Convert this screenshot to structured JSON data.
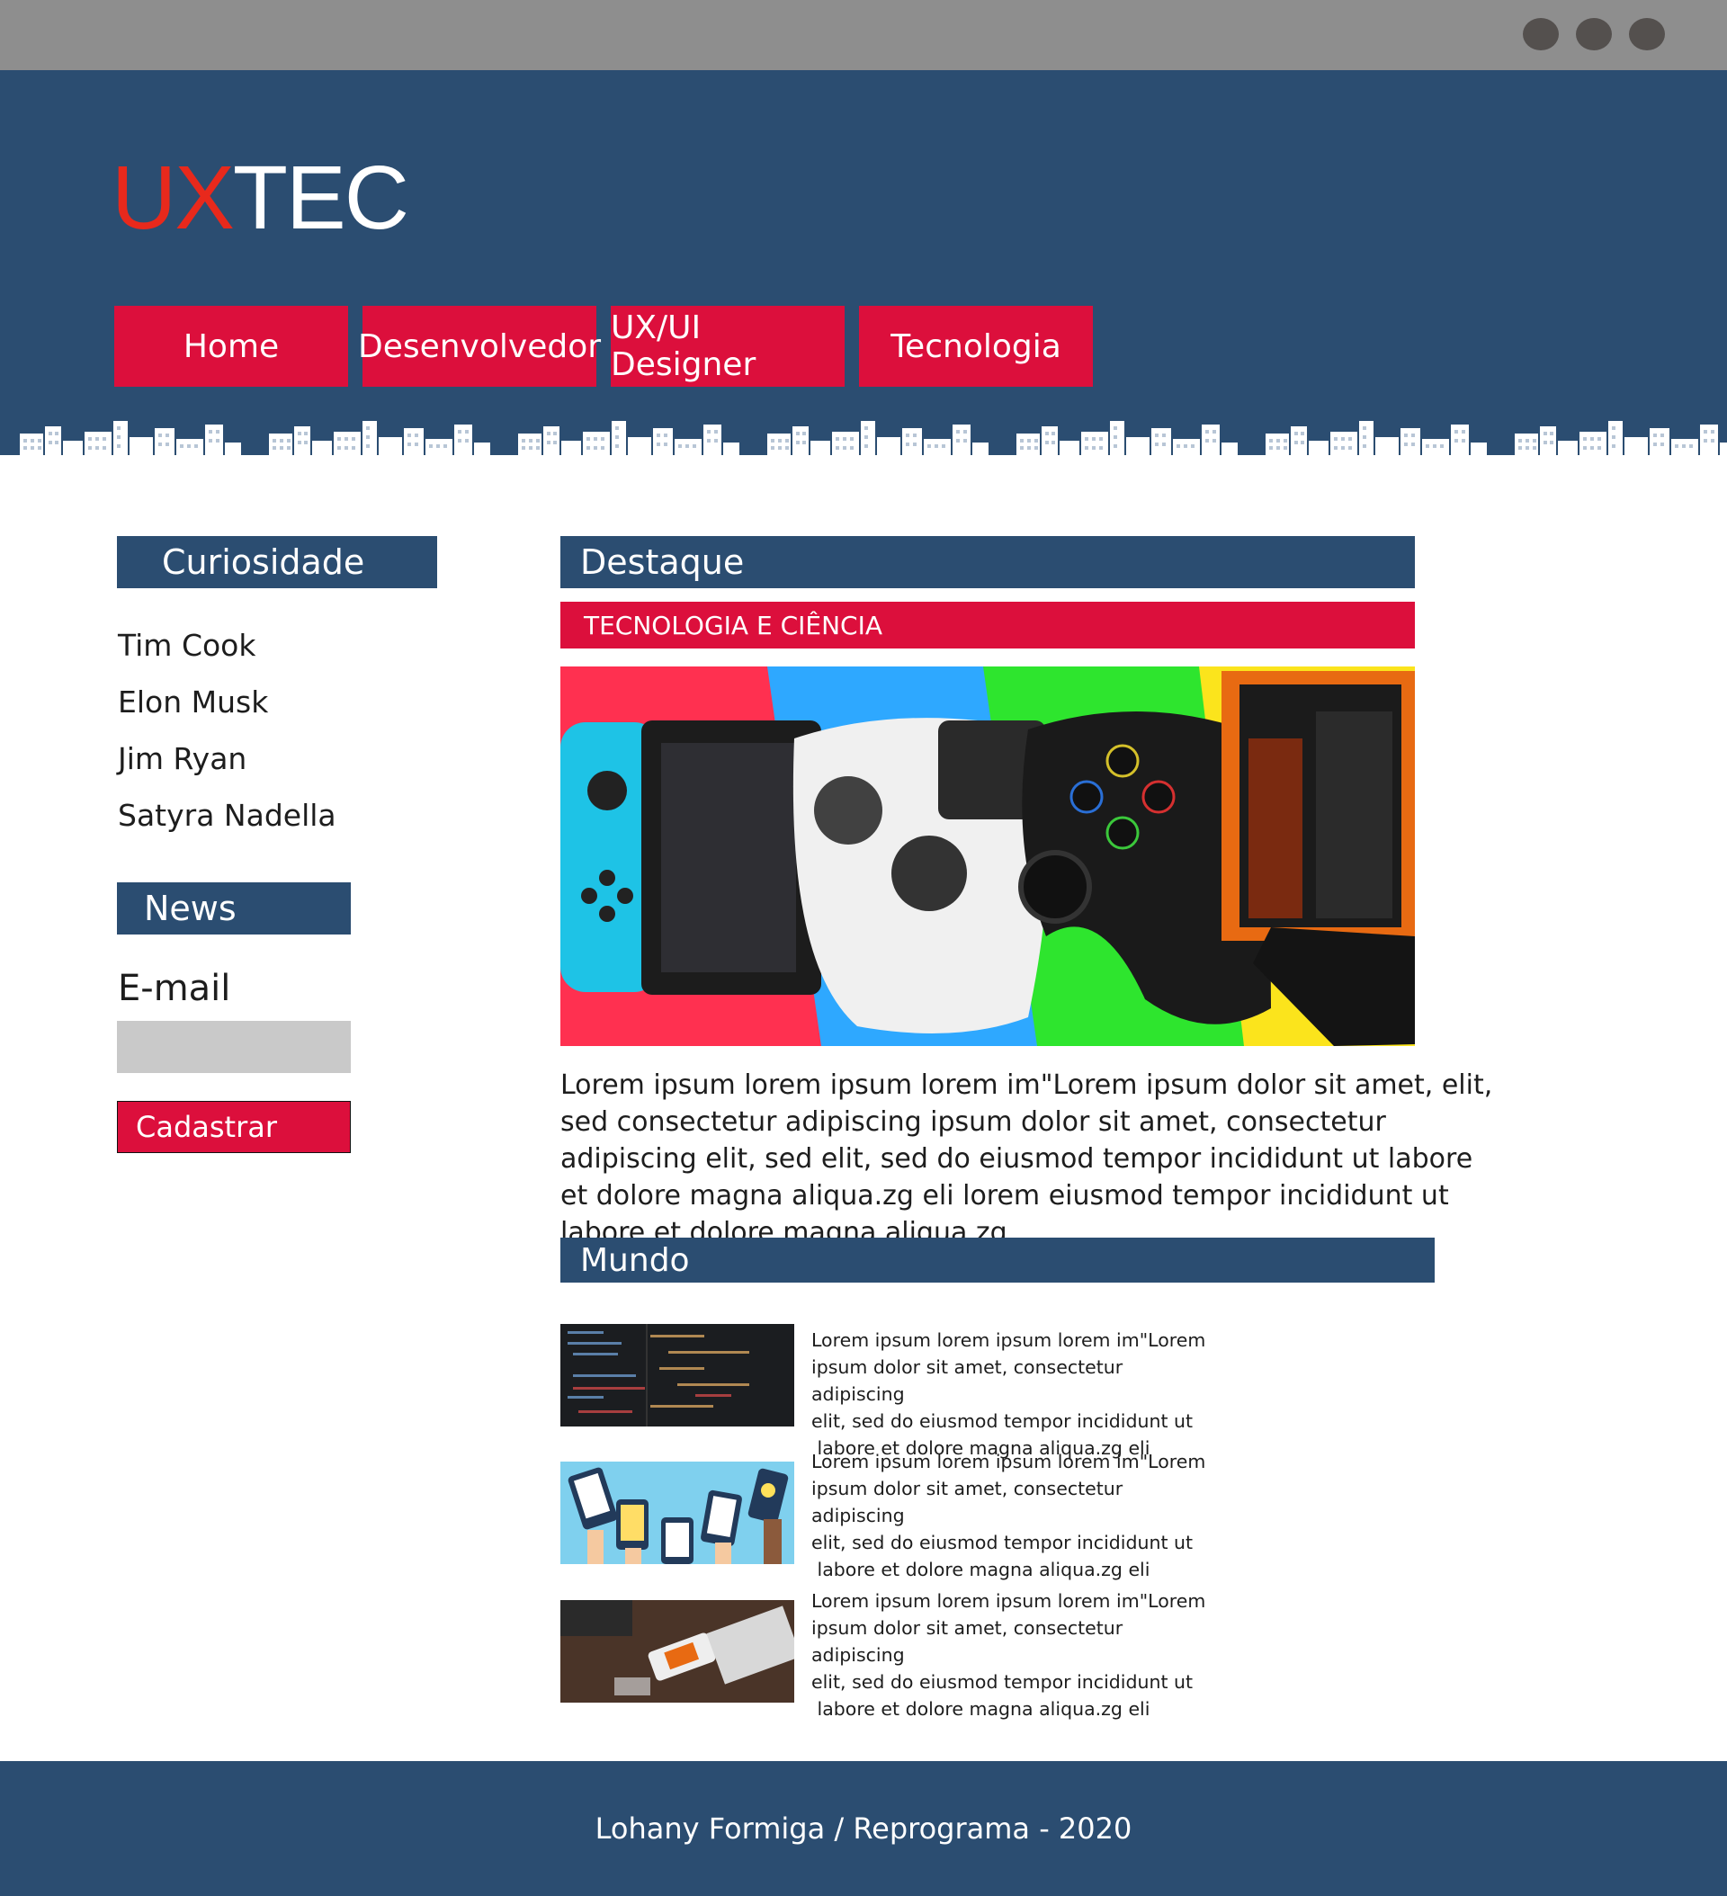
{
  "logo": {
    "part1": "UX",
    "part2": "TEC"
  },
  "nav": [
    {
      "label": "Home"
    },
    {
      "label": "Desenvolvedor"
    },
    {
      "label": "UX/UI Designer"
    },
    {
      "label": "Tecnologia"
    }
  ],
  "sidebar": {
    "curiosidade_title": "Curiosidade",
    "curiosidade_items": [
      "Tim Cook",
      "Elon Musk",
      "Jim Ryan",
      "Satyra Nadella"
    ],
    "news_title": "News",
    "email_label": "E-mail",
    "email_value": "",
    "submit_label": "Cadastrar"
  },
  "main": {
    "destaque_title": "Destaque",
    "category_label": "TECNOLOGIA E CIÊNCIA",
    "article_text": "Lorem ipsum lorem ipsum lorem im\"Lorem ipsum dolor sit amet, elit, sed consectetur adipiscing ipsum dolor sit amet, consectetur adipiscing elit, sed elit, sed do eiusmod tempor incididunt ut labore et dolore magna aliqua.zg eli lorem eiusmod tempor incididunt ut labore et dolore magna aliqua.zg.",
    "mundo_title": "Mundo",
    "mundo_items": [
      {
        "line1": "Lorem ipsum lorem ipsum lorem im\"Lorem",
        "line2": "ipsum dolor sit amet, consectetur adipiscing",
        "line3": "elit, sed do eiusmod tempor incididunt ut",
        "line4": " labore et dolore magna aliqua.zg eli"
      },
      {
        "line1": "Lorem ipsum lorem ipsum lorem im\"Lorem",
        "line2": "ipsum dolor sit amet, consectetur adipiscing",
        "line3": "elit, sed do eiusmod tempor incididunt ut",
        "line4": " labore et dolore magna aliqua.zg eli"
      },
      {
        "line1": "Lorem ipsum lorem ipsum lorem im\"Lorem",
        "line2": "ipsum dolor sit amet, consectetur adipiscing",
        "line3": "elit, sed do eiusmod tempor incididunt ut",
        "line4": " labore et dolore magna aliqua.zg eli"
      }
    ]
  },
  "footer": {
    "text": "Lohany Formiga / Reprograma - 2020"
  },
  "colors": {
    "navy": "#2b4d71",
    "accent_red": "#dc0f3c",
    "logo_red": "#e8291c",
    "chrome_gray": "#8e8e8e"
  }
}
